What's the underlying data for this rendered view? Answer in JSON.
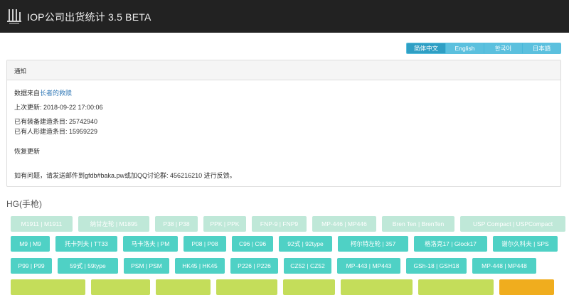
{
  "header": {
    "title": "IOP公司出货统计 3.5 BETA"
  },
  "languages": [
    {
      "label": "简体中文",
      "active": true
    },
    {
      "label": "English",
      "active": false
    },
    {
      "label": "한국어",
      "active": false
    },
    {
      "label": "日本語",
      "active": false
    }
  ],
  "notice": {
    "heading": "通知",
    "source_prefix": "数据来自",
    "source_link": "长者的救赎",
    "last_update": "上次更新: 2018-09-22 17:00:06",
    "equipment_count": "已有装备建造条目: 25742940",
    "doll_count": "已有人形建造条目: 15959229",
    "resume": "恢复更新",
    "contact": "如有问题，请发送邮件到gfdb#baka.pw或加QQ讨论群: 456216210 进行反馈。"
  },
  "section": {
    "title": "HG(手枪)"
  },
  "buttons": {
    "row1": [
      "M1911 | M1911",
      "纳甘左轮 | M1895",
      "P38 | P38",
      "PPK | PPK",
      "FNP-9 | FNP9",
      "MP-446 | MP446",
      "Bren Ten | BrenTen",
      "USP Compact | USPCompact"
    ],
    "row2": [
      "M9 | M9",
      "托卡列夫 | TT33",
      "马卡洛夫 | PM",
      "P08 | P08",
      "C96 | C96",
      "92式 | 92type",
      "柯尔特左轮 | 357",
      "格洛克17 | Glock17",
      "谢尔久科夫 | SPS"
    ],
    "row3": [
      "P99 | P99",
      "59式 | 59type",
      "PSM | PSM",
      "HK45 | HK45",
      "P226 | P226",
      "CZ52 | CZ52",
      "MP-443 | MP443",
      "GSh-18 | GSH18",
      "MP-448 | MP448"
    ]
  },
  "colors": {
    "topbar": "#222222",
    "lang_button": "#5bc0de",
    "row1_button": "#bfe8d8",
    "row2_button": "#4fd1c5",
    "row4_button": "#c4dd5a",
    "row4_orange": "#f0ad1e"
  },
  "icons": {
    "logo": "site-logo-icon"
  }
}
